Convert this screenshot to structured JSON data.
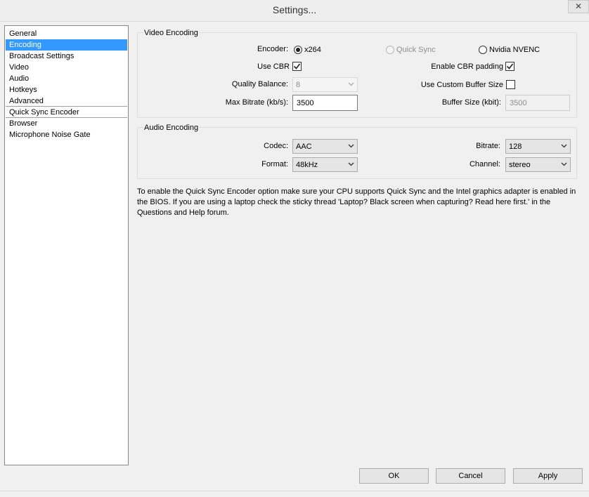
{
  "window": {
    "title": "Settings...",
    "close_glyph": "✕"
  },
  "sidebar": {
    "items": [
      {
        "label": "General"
      },
      {
        "label": "Encoding",
        "selected": true
      },
      {
        "label": "Broadcast Settings"
      },
      {
        "label": "Video"
      },
      {
        "label": "Audio"
      },
      {
        "label": "Hotkeys"
      },
      {
        "label": "Advanced"
      },
      {
        "label": "Quick Sync Encoder"
      },
      {
        "label": "Browser"
      },
      {
        "label": "Microphone Noise Gate"
      }
    ]
  },
  "video_encoding": {
    "title": "Video Encoding",
    "encoder_label": "Encoder:",
    "encoder_options": [
      "x264",
      "Quick Sync",
      "Nvidia NVENC"
    ],
    "encoder_selected": "x264",
    "use_cbr_label": "Use CBR",
    "use_cbr_checked": true,
    "cbr_padding_label": "Enable CBR padding",
    "cbr_padding_checked": true,
    "quality_label": "Quality Balance:",
    "quality_value": "8",
    "custom_buffer_label": "Use Custom Buffer Size",
    "custom_buffer_checked": false,
    "max_bitrate_label": "Max Bitrate (kb/s):",
    "max_bitrate_value": "3500",
    "buffer_size_label": "Buffer Size (kbit):",
    "buffer_size_value": "3500"
  },
  "audio_encoding": {
    "title": "Audio Encoding",
    "codec_label": "Codec:",
    "codec_value": "AAC",
    "format_label": "Format:",
    "format_value": "48kHz",
    "bitrate_label": "Bitrate:",
    "bitrate_value": "128",
    "channel_label": "Channel:",
    "channel_value": "stereo"
  },
  "info_text": "To enable the Quick Sync Encoder option make sure your CPU supports Quick Sync and the Intel graphics adapter is enabled in the BIOS. If you are using a laptop check the sticky thread 'Laptop? Black screen when capturing? Read here first.' in the Questions and Help forum.",
  "buttons": {
    "ok": "OK",
    "cancel": "Cancel",
    "apply": "Apply"
  },
  "colors": {
    "selection": "#3399ff",
    "window_bg": "#f0f0f0"
  }
}
